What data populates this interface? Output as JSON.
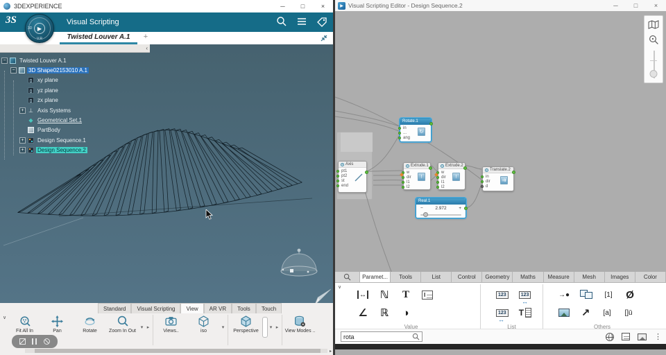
{
  "left_window": {
    "os": {
      "title": "3DEXPERIENCE",
      "min": "─",
      "max": "□",
      "close": "×"
    },
    "header": {
      "logo": "3S",
      "app_title": "Visual Scripting",
      "compass": {
        "left_label": "3D",
        "bottom_label": "V.R",
        "play": "▶"
      }
    },
    "tabbar": {
      "active_tab": "Twisted Louver A.1",
      "add_tab": "+",
      "collapse": "‹"
    },
    "tree": [
      {
        "label": "Twisted Louver A.1",
        "depth": 0,
        "expander": "−",
        "icon": "product",
        "style": "plain"
      },
      {
        "label": "3D Shape02153010 A.1",
        "depth": 1,
        "expander": "−",
        "icon": "shape",
        "style": "selected"
      },
      {
        "label": "xy plane",
        "depth": 2,
        "expander": "",
        "icon": "plane",
        "style": "plain"
      },
      {
        "label": "yz plane",
        "depth": 2,
        "expander": "",
        "icon": "plane",
        "style": "plain"
      },
      {
        "label": "zx plane",
        "depth": 2,
        "expander": "",
        "icon": "plane",
        "style": "plain"
      },
      {
        "label": "Axis Systems",
        "depth": 2,
        "expander": "+",
        "icon": "axis",
        "style": "plain"
      },
      {
        "label": "Geometrical Set.1",
        "depth": 2,
        "expander": "",
        "icon": "geoset",
        "style": "underline"
      },
      {
        "label": "PartBody",
        "depth": 2,
        "expander": "",
        "icon": "partbody",
        "style": "plain"
      },
      {
        "label": "Design Sequence.1",
        "depth": 2,
        "expander": "+",
        "icon": "sequence",
        "style": "plain"
      },
      {
        "label": "Design Sequence.2",
        "depth": 2,
        "expander": "+",
        "icon": "sequence",
        "style": "highlight"
      }
    ],
    "ribbon_tabs": [
      {
        "label": "Standard",
        "active": false
      },
      {
        "label": "Visual Scripting",
        "active": false
      },
      {
        "label": "View",
        "active": true
      },
      {
        "label": "AR VR",
        "active": false
      },
      {
        "label": "Tools",
        "active": false
      },
      {
        "label": "Touch",
        "active": false
      }
    ],
    "tools": [
      {
        "label": "Fit All In",
        "icon": "fit",
        "sep_after": false,
        "dropdown": false,
        "expand": false
      },
      {
        "label": "Pan",
        "icon": "pan",
        "sep_after": false,
        "dropdown": false,
        "expand": false
      },
      {
        "label": "Rotate",
        "icon": "rotate",
        "sep_after": false,
        "dropdown": false,
        "expand": false
      },
      {
        "label": "Zoom In Out",
        "icon": "zoom",
        "sep_after": true,
        "dropdown": true,
        "expand": true
      },
      {
        "label": "Views..",
        "icon": "camera",
        "sep_after": false,
        "dropdown": false,
        "expand": false
      },
      {
        "label": "iso",
        "icon": "isocube",
        "sep_after": true,
        "dropdown": true,
        "expand": false
      },
      {
        "label": "Perspective",
        "icon": "perspective",
        "sep_after": true,
        "dropdown": true,
        "expand": true
      },
      {
        "label": "View Modes ..",
        "icon": "viewmodes",
        "sep_after": false,
        "dropdown": false,
        "expand": false
      }
    ]
  },
  "right_window": {
    "os": {
      "title": "Visual Scripting Editor - Design Sequence.2",
      "min": "─",
      "max": "□",
      "close": "×"
    },
    "graph": {
      "nodes": {
        "axis": {
          "title": "Axis",
          "ports": [
            "pt1",
            "pt2",
            "st",
            "end"
          ]
        },
        "rotate1": {
          "title": "Rotate.1",
          "ports": [
            "in",
            "...",
            "ang"
          ]
        },
        "extrude1": {
          "title": "Extrude.1",
          "ports": [
            "w",
            "dir",
            "l1",
            "l2"
          ]
        },
        "extrude2": {
          "title": "Extrude.2",
          "ports": [
            "w",
            "dir",
            "l1",
            "l2"
          ]
        },
        "translate2": {
          "title": "Translate.2",
          "ports": [
            "in",
            "dir",
            "d"
          ]
        },
        "real1": {
          "title": "Real.1",
          "value": "2.972",
          "minus": "−",
          "plus": "+"
        }
      }
    },
    "palette": {
      "tabs": [
        {
          "label": "Paramet...",
          "active": true
        },
        {
          "label": "Tools",
          "active": false
        },
        {
          "label": "List",
          "active": false
        },
        {
          "label": "Control",
          "active": false
        },
        {
          "label": "Geometry",
          "active": false
        },
        {
          "label": "Maths",
          "active": false
        },
        {
          "label": "Measure",
          "active": false
        },
        {
          "label": "Mesh",
          "active": false
        },
        {
          "label": "Images",
          "active": false
        },
        {
          "label": "Color",
          "active": false
        }
      ],
      "groups": [
        {
          "label": "Value",
          "rows": [
            [
              {
                "name": "length-icon",
                "glyph": "↔",
                "cls": "caps"
              },
              {
                "name": "integer-icon",
                "glyph": "ℕ",
                "cls": "big"
              },
              {
                "name": "text-icon",
                "glyph": "T",
                "cls": "big serifT"
              },
              {
                "name": "multiline-text-icon",
                "glyph": "I",
                "cls": "doc"
              }
            ],
            [
              {
                "name": "angle-icon",
                "glyph": "∠",
                "cls": "big"
              },
              {
                "name": "real-icon",
                "glyph": "ℝ",
                "cls": "big"
              },
              {
                "name": "boolean-icon",
                "glyph": "◑",
                "cls": "big"
              }
            ]
          ]
        },
        {
          "label": "List",
          "rows": [
            [
              {
                "name": "integer-list-icon",
                "glyph": "123",
                "cls": "box123"
              },
              {
                "name": "range-list-icon",
                "glyph": "123",
                "cls": "box123 arrow"
              }
            ],
            [
              {
                "name": "series-list-icon",
                "glyph": "123",
                "cls": "box123 arrow2"
              },
              {
                "name": "text-list-icon",
                "glyph": "T",
                "cls": "tlist"
              }
            ]
          ]
        },
        {
          "label": "Others",
          "rows": [
            [
              {
                "name": "point-icon",
                "glyph": "→●",
                "cls": ""
              },
              {
                "name": "duplicate-icon",
                "glyph": "",
                "cls": "dupsq"
              },
              {
                "name": "list-index-icon",
                "glyph": "[1]",
                "cls": ""
              },
              {
                "name": "null-icon",
                "glyph": "Ø",
                "cls": "big"
              }
            ],
            [
              {
                "name": "image-icon",
                "glyph": "",
                "cls": "imgic"
              },
              {
                "name": "line-icon",
                "glyph": "↗",
                "cls": "big"
              },
              {
                "name": "attribute-icon",
                "glyph": "[a]",
                "cls": ""
              },
              {
                "name": "vector-list-icon",
                "glyph": "[]ū",
                "cls": ""
              }
            ]
          ]
        }
      ],
      "search": {
        "value": "rota"
      }
    }
  }
}
